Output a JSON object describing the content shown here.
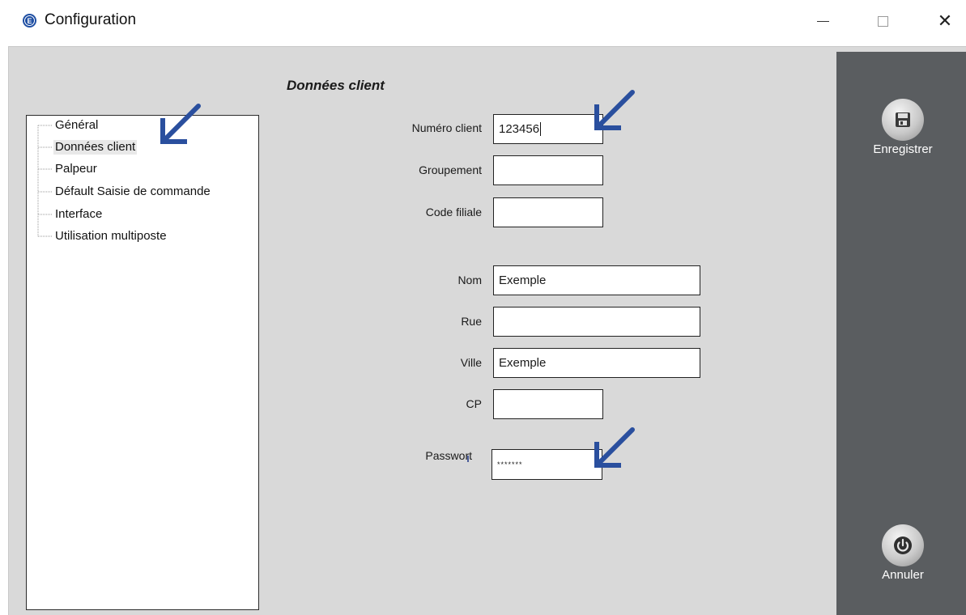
{
  "window": {
    "title": "Configuration",
    "app_icon_letter": "E"
  },
  "tree": {
    "items": [
      {
        "label": "Général"
      },
      {
        "label": "Données client",
        "selected": true
      },
      {
        "label": "Palpeur"
      },
      {
        "label": "Défault Saisie de commande"
      },
      {
        "label": "Interface"
      },
      {
        "label": "Utilisation multiposte"
      }
    ]
  },
  "form": {
    "section_title": "Données client",
    "fields": {
      "numero_client": {
        "label": "Numéro client",
        "value": "123456"
      },
      "groupement": {
        "label": "Groupement",
        "value": ""
      },
      "code_filiale": {
        "label": "Code filiale",
        "value": ""
      },
      "nom": {
        "label": "Nom",
        "value": "Exemple"
      },
      "rue": {
        "label": "Rue",
        "value": ""
      },
      "ville": {
        "label": "Ville",
        "value": "Exemple"
      },
      "cp": {
        "label": "CP",
        "value": ""
      },
      "passwort": {
        "label": "Passwort",
        "value": "*******"
      }
    }
  },
  "side": {
    "save_label": "Enregistrer",
    "cancel_label": "Annuler"
  },
  "colors": {
    "annotation_arrow": "#2a4f9e",
    "side_panel": "#5a5d60",
    "content_bg": "#d9d9d9"
  },
  "icons": {
    "save": "floppy-disk-icon",
    "cancel": "power-icon",
    "close": "close-icon",
    "minimize": "minimize-icon",
    "maximize": "maximize-icon"
  }
}
